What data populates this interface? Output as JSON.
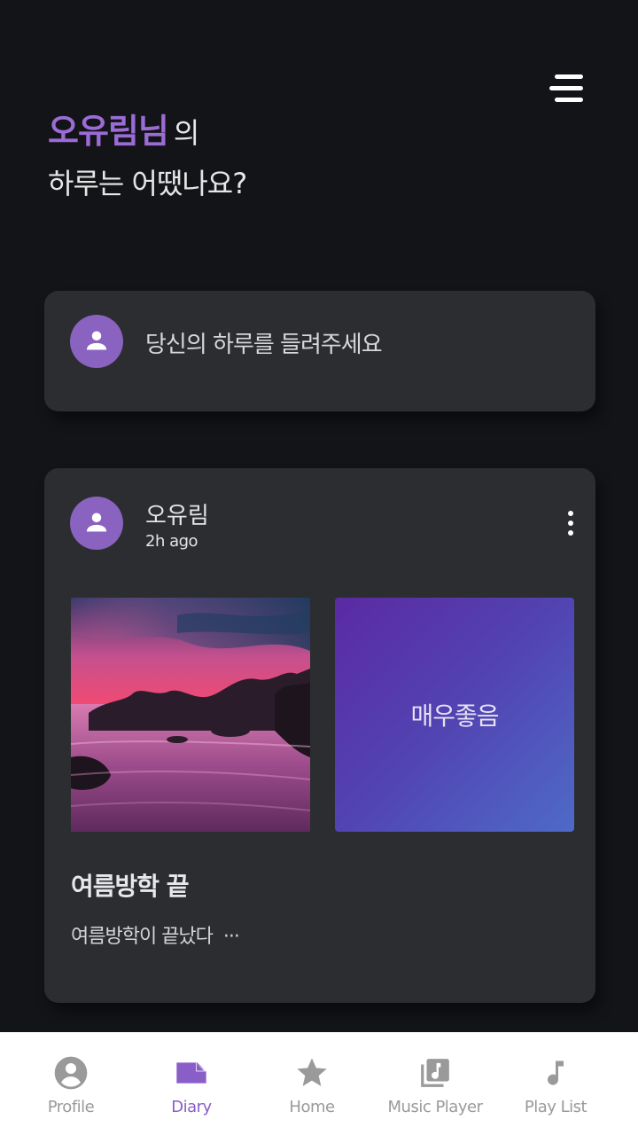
{
  "header": {
    "user_name": "오유림님",
    "greeting_suffix": "의",
    "greeting_question": "하루는 어땠나요?"
  },
  "compose": {
    "prompt": "당신의 하루를 들려주세요"
  },
  "post": {
    "author": "오유림",
    "time": "2h ago",
    "mood_label": "매우좋음",
    "title": "여름방학 끝",
    "body": "여름방학이 끝났다",
    "ellipsis": "···"
  },
  "nav": {
    "items": [
      {
        "label": "Profile",
        "icon": "account-circle-icon"
      },
      {
        "label": "Diary",
        "icon": "note-icon",
        "active": true
      },
      {
        "label": "Home",
        "icon": "star-icon"
      },
      {
        "label": "Music Player",
        "icon": "music-library-icon"
      },
      {
        "label": "Play List",
        "icon": "music-note-icon"
      }
    ]
  },
  "colors": {
    "background": "#131418",
    "card": "#2c2d31",
    "accent": "#9b6cd6",
    "avatar": "#8a62bf",
    "nav_inactive": "#9a9a9a"
  }
}
